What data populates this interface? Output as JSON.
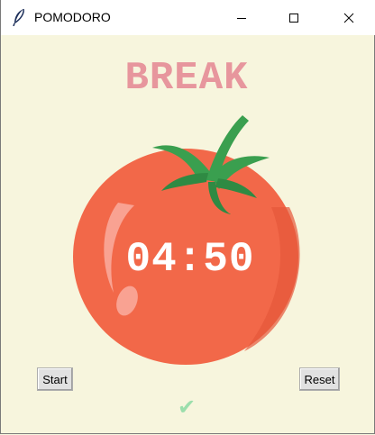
{
  "window": {
    "title": "POMODORO",
    "controls": {
      "minimize": "minimize-icon",
      "maximize": "maximize-icon",
      "close": "close-icon"
    },
    "app_icon": "feather-icon"
  },
  "main": {
    "heading": "BREAK",
    "timer": "04:50",
    "start_label": "Start",
    "reset_label": "Reset",
    "checkmarks": "✔"
  },
  "colors": {
    "background": "#f7f5dd",
    "heading": "#e7969d",
    "check": "#9bdeac",
    "tomato": "#f26849",
    "leaf": "#3a9f4f"
  }
}
